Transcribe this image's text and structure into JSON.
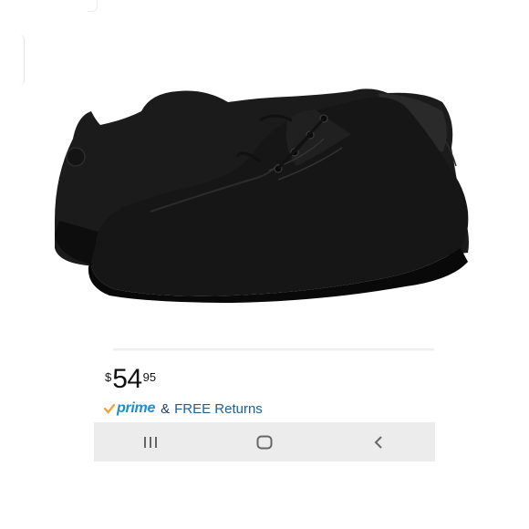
{
  "product": {
    "image_alt": "black leather lace-up oxford shoes",
    "price": {
      "currency_symbol": "$",
      "whole": "54",
      "fraction": "95"
    },
    "shipping": {
      "prime_label": "prime",
      "ampersand": "&",
      "returns_label": "FREE Returns"
    }
  },
  "navigation": {
    "buttons": [
      "recent-apps",
      "home",
      "back"
    ]
  },
  "colors": {
    "prime_blue": "#1a8fd0",
    "prime_check": "#f0a030",
    "returns_blue": "#1f5f93",
    "nav_bar": "#ececec"
  }
}
